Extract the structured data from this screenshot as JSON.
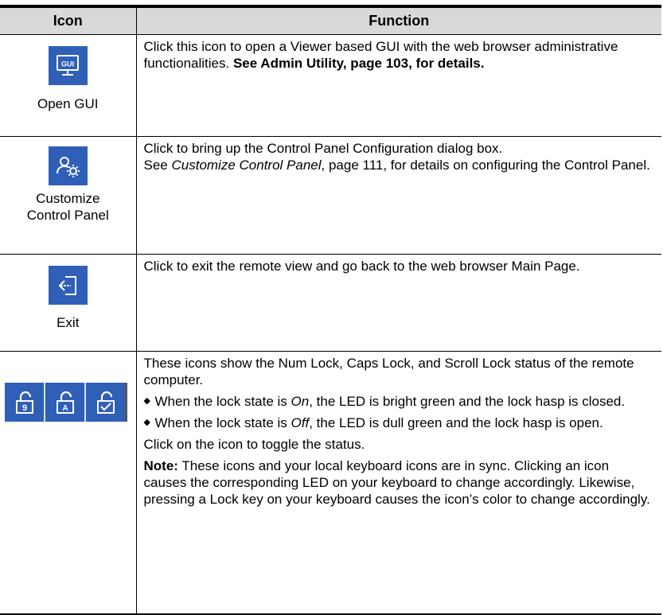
{
  "header": {
    "icon_col": "Icon",
    "function_col": "Function"
  },
  "rows": [
    {
      "icon_name": "gui-monitor-icon",
      "caption": "Open GUI",
      "desc_text": "Click this icon to open a Viewer based GUI with the web browser administrative functionalities. ",
      "desc_bold": "See Admin Utility, page 103, for details."
    },
    {
      "icon_name": "user-gear-icon",
      "caption_line1": "Customize",
      "caption_line2": "Control Panel",
      "line1": "Click to bring up the Control Panel Configuration dialog box.",
      "line2_pre": "See ",
      "line2_italic": "Customize Control Panel",
      "line2_post": ", page 111, for details on configuring the Control Panel."
    },
    {
      "icon_name": "exit-icon",
      "caption": "Exit",
      "desc": "Click to exit the remote view and go back to the web browser Main Page."
    },
    {
      "icons": [
        "num-lock-icon",
        "caps-lock-icon",
        "scroll-lock-icon"
      ],
      "intro": "These icons show the Num Lock, Caps Lock, and Scroll Lock status of the remote computer.",
      "bullet_marker": "◆",
      "bullet1_pre": "When the lock state is ",
      "bullet1_em": "On",
      "bullet1_post": ", the LED is bright green and the lock hasp is closed.",
      "bullet2_pre": "When the lock state is ",
      "bullet2_em": "Off",
      "bullet2_post": ", the LED is dull green and the lock hasp is open.",
      "toggle": "Click on the icon to toggle the status.",
      "note_label": "Note:",
      "note_text": " These icons and your local keyboard icons are in sync. Clicking an icon causes the corresponding LED on your keyboard to change accordingly. Likewise, pressing a Lock key on your keyboard causes the icon’s color to change accordingly.",
      "glyph_num": "9",
      "glyph_caps": "A"
    }
  ],
  "colors": {
    "icon_bg": "#2f5fb7",
    "header_bg": "#d9d9d9"
  },
  "gui_label": "GUI"
}
